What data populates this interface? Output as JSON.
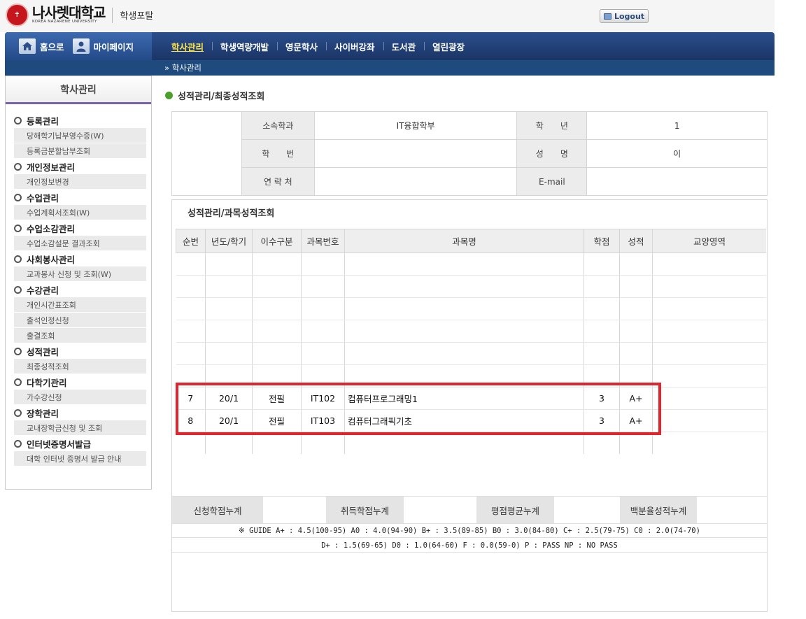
{
  "header": {
    "logo_name": "나사렛대학교",
    "logo_sub": "KOREA NAZARENE UNIVERSITY",
    "portal": "학생포탈",
    "logout": "Logout"
  },
  "nav": {
    "home": "홈으로",
    "mypage": "마이페이지",
    "items": [
      "학사관리",
      "학생역량개발",
      "영문학사",
      "사이버강좌",
      "도서관",
      "열린광장"
    ],
    "active": "학사관리",
    "breadcrumb": "» 학사관리"
  },
  "sidebar": {
    "title": "학사관리",
    "groups": [
      {
        "title": "등록관리",
        "items": [
          "당해학기납부영수증(W)",
          "등록금분할납부조회"
        ]
      },
      {
        "title": "개인정보관리",
        "items": [
          "개인정보변경"
        ]
      },
      {
        "title": "수업관리",
        "items": [
          "수업계획서조회(W)"
        ]
      },
      {
        "title": "수업소감관리",
        "items": [
          "수업소감설문 결과조회"
        ]
      },
      {
        "title": "사회봉사관리",
        "items": [
          "교과봉사 신청 및 조회(W)"
        ]
      },
      {
        "title": "수강관리",
        "items": [
          "개인시간표조회",
          "출석인정신청",
          "출결조회"
        ]
      },
      {
        "title": "성적관리",
        "items": [
          "최종성적조회"
        ]
      },
      {
        "title": "다학기관리",
        "items": [
          "가수강신청"
        ]
      },
      {
        "title": "장학관리",
        "items": [
          "교내장학금신청 및 조회"
        ]
      },
      {
        "title": "인터넷증명서발급",
        "items": [
          "대학 인터넷 증명서 발급 안내"
        ]
      }
    ]
  },
  "page": {
    "title": "성적관리/최종성적조회",
    "panel_title": "성적관리/과목성적조회"
  },
  "info": {
    "labels": [
      "소속학과",
      "학　　년",
      "학　　번",
      "성　　명",
      "연 락 처",
      "E-mail"
    ],
    "values": [
      "IT융합학부",
      "1",
      "",
      "이",
      "",
      ""
    ]
  },
  "grades": {
    "headers": [
      "순번",
      "년도/학기",
      "이수구분",
      "과목번호",
      "과목명",
      "학점",
      "성적",
      "교양영역"
    ],
    "rows": [
      [
        "7",
        "20/1",
        "전필",
        "IT102",
        "컴퓨터프로그래밍1",
        "3",
        "A+",
        ""
      ],
      [
        "8",
        "20/1",
        "전필",
        "IT103",
        "컴퓨터그래픽기초",
        "3",
        "A+",
        ""
      ]
    ]
  },
  "summary": {
    "labels": [
      "신청학점누계",
      "취득학점누계",
      "평점평균누계",
      "백분율성적누계"
    ],
    "values": [
      "",
      "",
      "",
      ""
    ]
  },
  "guide": {
    "line1": "※ GUIDE   A+ : 4.5(100-95) A0 : 4.0(94-90)  B+ : 3.5(89-85) B0 : 3.0(84-80) C+ : 2.5(79-75)  C0 : 2.0(74-70)",
    "line2": "D+ : 1.5(69-65)  D0 : 1.0(64-60)  F : 0.0(59-0)  P : PASS  NP : NO PASS"
  },
  "colors": {
    "nav": "#1f3f78",
    "active_nav": "#ffe54a",
    "highlight": "#e0262c",
    "title_dot": "#4b9f2c"
  }
}
